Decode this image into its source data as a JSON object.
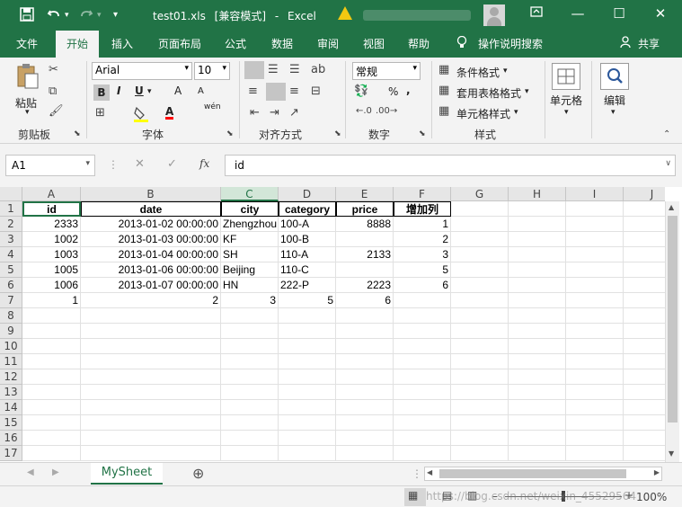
{
  "titlebar": {
    "filename": "test01.xls",
    "mode": "[兼容模式]",
    "separator": "-",
    "app": "Excel",
    "qa_save_icon": "save-icon",
    "qa_undo_icon": "undo-icon",
    "qa_redo_icon": "redo-icon"
  },
  "tabs": [
    "文件",
    "开始",
    "插入",
    "页面布局",
    "公式",
    "数据",
    "审阅",
    "视图",
    "帮助"
  ],
  "tell_me": "操作说明搜索",
  "share": "共享",
  "ribbon": {
    "clipboard": {
      "paste": "粘贴",
      "label": "剪贴板"
    },
    "font": {
      "name": "Arial",
      "size": "10",
      "label": "字体",
      "bold": "B",
      "italic": "I",
      "underline": "U",
      "grow": "A",
      "shrink": "A",
      "wen": "wén",
      "color_a": "A"
    },
    "alignment": {
      "label": "对齐方式"
    },
    "number": {
      "format": "常规",
      "label": "数字",
      "percent": "%",
      "comma": ","
    },
    "styles": {
      "conditional": "条件格式",
      "table": "套用表格格式",
      "cell": "单元格样式",
      "label": "样式"
    },
    "cells": {
      "label": "单元格"
    },
    "editing": {
      "label": "编辑"
    }
  },
  "formula_bar": {
    "name_box": "A1",
    "fx": "fx",
    "content": "id"
  },
  "columns": [
    "A",
    "B",
    "C",
    "D",
    "E",
    "F",
    "G",
    "H",
    "I",
    "J"
  ],
  "rows": [
    "1",
    "2",
    "3",
    "4",
    "5",
    "6",
    "7",
    "8",
    "9",
    "10",
    "11",
    "12",
    "13",
    "14",
    "15",
    "16",
    "17"
  ],
  "table": {
    "headers": [
      "id",
      "date",
      "city",
      "category",
      "price",
      "增加列"
    ],
    "data": [
      [
        "2333",
        "2013-01-02 00:00:00",
        "Zhengzhou",
        "100-A",
        "8888",
        "1"
      ],
      [
        "1002",
        "2013-01-03 00:00:00",
        "KF",
        "100-B",
        "",
        "2"
      ],
      [
        "1003",
        "2013-01-04 00:00:00",
        "SH",
        "110-A",
        "2133",
        "3"
      ],
      [
        "1005",
        "2013-01-06 00:00:00",
        "Beijing",
        "110-C",
        "",
        "5"
      ],
      [
        "1006",
        "2013-01-07 00:00:00",
        "HN",
        "222-P",
        "2223",
        "6"
      ],
      [
        "1",
        "2",
        "3",
        "5",
        "6",
        ""
      ]
    ]
  },
  "sheet_tab": "MySheet",
  "status": {
    "zoom": "100%",
    "watermark": "https://blog.csdn.net/weixin_45529564"
  }
}
